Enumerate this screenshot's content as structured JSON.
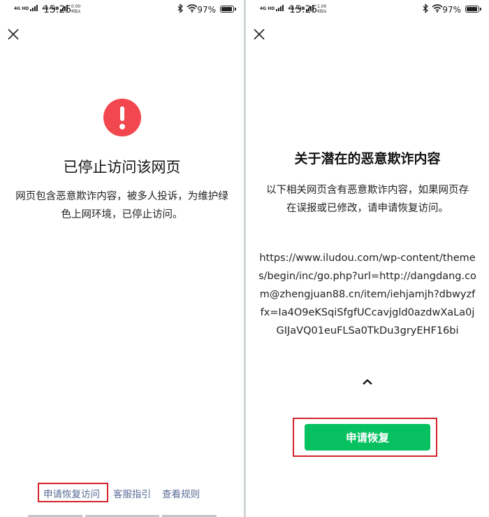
{
  "left": {
    "status": {
      "net1": "4G HD",
      "net2": "4G+HD",
      "time": "15:25",
      "speed_value": "0.00",
      "speed_unit": "KB/s",
      "battery": "97%",
      "battery_level": 0.97
    },
    "icons": {
      "close": "close-icon",
      "warning": "exclamation-warning-icon"
    },
    "title": "已停止访问该网页",
    "description": "网页包含恶意欺诈内容，被多人投诉，为维护绿色上网环境，已停止访问。",
    "links": {
      "appeal": "申请恢复访问",
      "support": "客服指引",
      "rules": "查看规则"
    }
  },
  "right": {
    "status": {
      "net1": "4G HD",
      "net2": "4G+HD",
      "time": "15:25",
      "speed_value": "1.00",
      "speed_unit": "KB/s",
      "battery": "97%",
      "battery_level": 0.97
    },
    "icons": {
      "close": "close-icon",
      "collapse": "chevron-up-icon"
    },
    "title": "关于潜在的恶意欺诈内容",
    "description": "以下相关网页含有恶意欺诈内容，如果网页存在误报或已修改，请申请恢复访问。",
    "url": "https://www.iludou.com/wp-content/themes/begin/inc/go.php?url=http://dangdang.com@zhengjuan88.cn/item/iehjamjh?dbwyzffx=Ia4O9eKSqiSfgfUCcavjgld0azdwXaLa0jGIJaVQ01euFLSa0TkDu3gryEHF16bi",
    "button": "申请恢复"
  },
  "colors": {
    "warning_red": "#f2474e",
    "link": "#586b95",
    "button_green": "#07c160",
    "highlight": "#d4232b"
  }
}
